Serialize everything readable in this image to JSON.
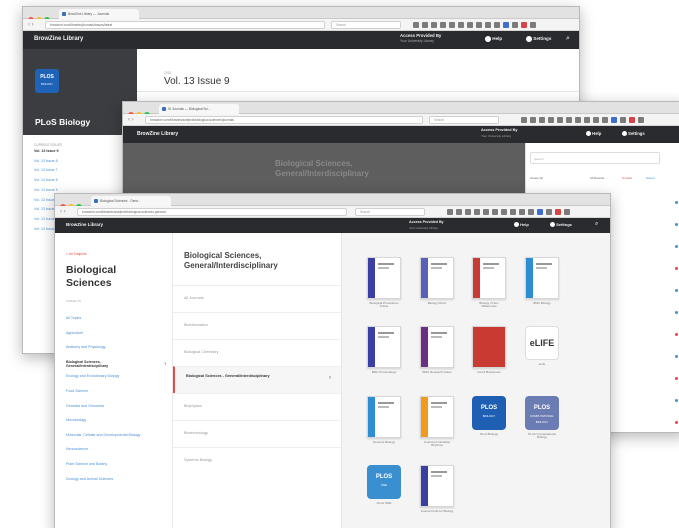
{
  "windows": {
    "back": {
      "browser_tab": "BrowZine Library — Journals",
      "url": "browzine.com/libraries/journals/issues/latest",
      "search_placeholder": "Search",
      "brand": "BrowZine Library",
      "access_title": "Access Provided By",
      "access_sub": "Your University Library",
      "help": "Help",
      "settings": "Settings",
      "journal_cover_logo": "PLOS",
      "journal_cover_sub": "BIOLOGY",
      "journal_title": "PLoS Biology",
      "issues_header": "CURRENT ISSUES",
      "issues_header_right": "2017",
      "issues": [
        "Vol. 13 Issue 9",
        "Vol. 13 Issue 8",
        "Vol. 13 Issue 7",
        "Vol. 13 Issue 6",
        "Vol. 13 Issue 5",
        "Vol. 13 Issue 4",
        "Vol. 13 Issue 3",
        "Vol. 13 Issue 2",
        "Vol. 13 Issue 1"
      ],
      "main_small": "2015",
      "main_title": "Vol. 13 Issue 9"
    },
    "middle": {
      "browser_tab": "St Journals — Biological Sci...",
      "url": "browzine.com/libraries/subjects/biological-sciences/journals",
      "search_placeholder": "Search",
      "brand": "BrowZine Library",
      "access_title": "Access Provided By",
      "access_sub": "Your University Library",
      "help": "Help",
      "settings": "Settings",
      "faded_heading": "Biological Sciences, General/Interdisciplinary",
      "panel_search": "Search",
      "panel_row": "Issues (9)",
      "panel_filter_all": "All Results",
      "panel_filter_unread": "Unread",
      "panel_filter_saved": "Saved"
    },
    "front": {
      "browser_tab": "Biological Sciences - Gene...",
      "url": "browzine.com/libraries/subjects/biological-sciences-general",
      "search_placeholder": "Search",
      "brand": "BrowZine Library",
      "access_title": "Access Provided By",
      "access_sub": "Your University Library",
      "help": "Help",
      "settings": "Settings",
      "breadcrumb": "< All Subjects",
      "category_title": "Biological Sciences",
      "subselect": "SUBJECTS",
      "categories": [
        {
          "label": "All Topics",
          "active": false
        },
        {
          "label": "Agriculture",
          "active": false
        },
        {
          "label": "Anatomy and Physiology",
          "active": false
        },
        {
          "label": "Biological Sciences, General/Interdisciplinary",
          "active": true
        },
        {
          "label": "Ecology and Evolutionary Biology",
          "active": false
        },
        {
          "label": "Food Science",
          "active": false
        },
        {
          "label": "Genetics and Genomics",
          "active": false
        },
        {
          "label": "Microbiology",
          "active": false
        },
        {
          "label": "Molecular, Cellular and Developmental Biology",
          "active": false
        },
        {
          "label": "Neuroscience",
          "active": false
        },
        {
          "label": "Plant Science and Botany",
          "active": false
        },
        {
          "label": "Zoology and Animal Sciences",
          "active": false
        }
      ],
      "subject_title": "Biological Sciences, General/Interdisciplinary",
      "subjects": [
        {
          "label": "All Journals",
          "active": false
        },
        {
          "label": "Bioinformatics",
          "active": false
        },
        {
          "label": "Biological Chemistry",
          "active": false
        },
        {
          "label": "Biological Sciences - General/Interdisciplinary",
          "active": true
        },
        {
          "label": "Biophysics",
          "active": false
        },
        {
          "label": "Biotechnology",
          "active": false
        },
        {
          "label": "Systems Biology",
          "active": false
        }
      ],
      "journals": [
        {
          "label": "Biological Procedures Online",
          "color": "#3b3fa3",
          "kind": "stripe"
        },
        {
          "label": "Biology Direct",
          "color": "#5a5fb8",
          "kind": "stripe"
        },
        {
          "label": "Biology of Sex Differences",
          "color": "#c93a33",
          "kind": "stripe"
        },
        {
          "label": "BMC Biology",
          "color": "#2f8ed1",
          "kind": "stripe"
        },
        {
          "label": "BMC Proceedings",
          "color": "#3b3fa3",
          "kind": "stripe"
        },
        {
          "label": "BMC Research Notes",
          "color": "#6a2f82",
          "kind": "stripe"
        },
        {
          "label": "Cell & Bioscience",
          "color": "#c93a33",
          "kind": "full"
        },
        {
          "label": "eLife",
          "color": "#ffffff",
          "kind": "elife",
          "logo": "eLIFE"
        },
        {
          "label": "Genome Biology",
          "color": "#2f8ed1",
          "kind": "stripe"
        },
        {
          "label": "Journal of Circadian Rhythms",
          "color": "#f29a1d",
          "kind": "stripe"
        },
        {
          "label": "PLoS Biology",
          "color": "#1f5fb3",
          "kind": "tile",
          "logo": "PLOS",
          "logo_sub": "BIOLOGY"
        },
        {
          "label": "PLoS Computational Biology",
          "color": "#6b7bb3",
          "kind": "tile",
          "logo": "PLOS",
          "logo_sub": "COMPUTATIONAL BIOLOGY"
        },
        {
          "label": "PLoS ONE",
          "color": "#3a8fd0",
          "kind": "tile",
          "logo": "PLOS",
          "logo_sub": "ONE"
        },
        {
          "label": "Journal Code for Biology",
          "color": "#3b3fa3",
          "kind": "stripe"
        }
      ]
    }
  }
}
